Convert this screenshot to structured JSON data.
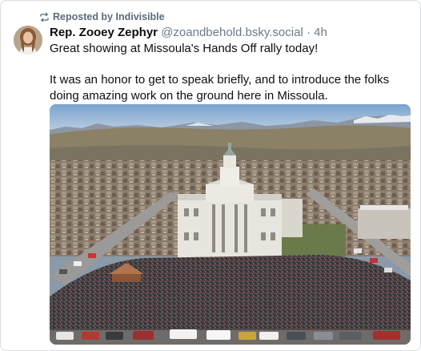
{
  "repost": {
    "icon": "repost-icon",
    "label": "Reposted by Indivisible"
  },
  "post": {
    "author_name": "Rep. Zooey Zephyr",
    "handle": "@zoandbehold.bsky.social",
    "separator": "·",
    "age": "4h",
    "avatar": "avatar-photo",
    "paragraphs": [
      "Great showing at Missoula's Hands Off rally today!",
      "It was an honor to get to speak briefly, and to introduce the folks doing amazing work on the ground here in Missoula."
    ],
    "image": {
      "description_icon": "aerial-rally-photo"
    }
  },
  "colors": {
    "repost_text": "#5b6b7c",
    "handle_text": "#6b7a8a",
    "border": "#d9dde2"
  }
}
